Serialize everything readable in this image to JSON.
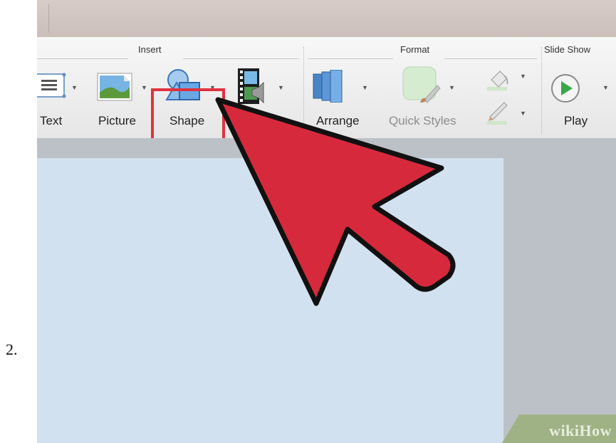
{
  "step_number": "2.",
  "ribbon": {
    "groups": {
      "insert": "Insert",
      "format": "Format",
      "slide_show": "Slide Show"
    },
    "tools": {
      "text": "Text",
      "picture": "Picture",
      "shape": "Shape",
      "arrange": "Arrange",
      "quick_styles": "Quick Styles",
      "play": "Play"
    }
  },
  "watermark": "wikiHow",
  "colors": {
    "highlight": "#e0323f",
    "arrow_fill": "#d62a3c",
    "slide_bg": "#d2e1f0",
    "play_green": "#3aa64a"
  },
  "icons": [
    "text-box-icon",
    "picture-icon",
    "shape-icon",
    "movie-icon",
    "arrange-icon",
    "quick-styles-icon",
    "fill-color-icon",
    "line-color-icon",
    "play-icon"
  ]
}
